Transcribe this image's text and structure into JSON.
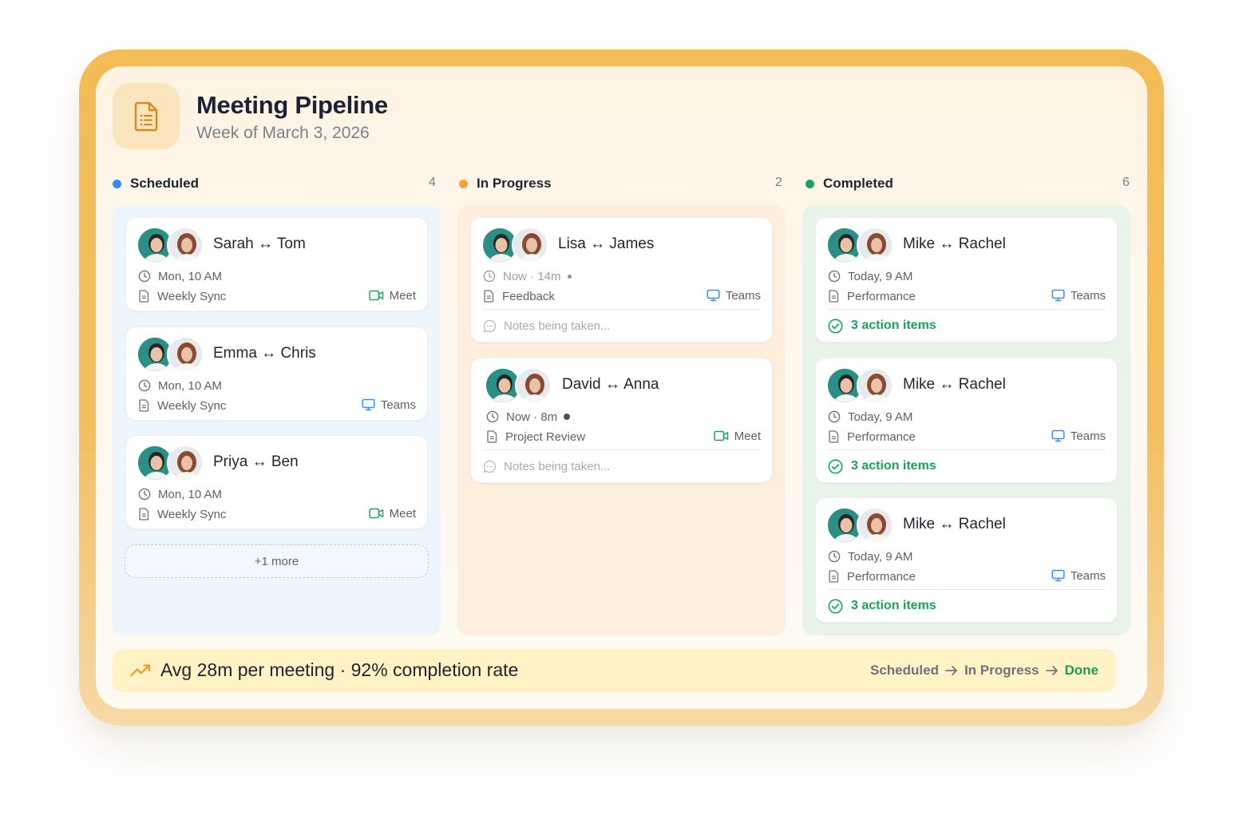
{
  "header": {
    "title": "Meeting Pipeline",
    "subtitle": "Week of March 3, 2026",
    "icon": "document-list-icon"
  },
  "columns": [
    {
      "name": "Scheduled",
      "count": "4",
      "dot_color": "#2f8cf0",
      "bg_color": "#eef6fd",
      "more_label": "+1 more",
      "cards": [
        {
          "title": "Sarah ↔ Tom",
          "time": "Mon, 10 AM",
          "topic": "Weekly Sync",
          "platform": "Meet",
          "platform_icon": "video-camera-icon"
        },
        {
          "title": "Emma ↔ Chris",
          "time": "Mon, 10 AM",
          "topic": "Weekly Sync",
          "platform": "Teams",
          "platform_icon": "monitor-icon"
        },
        {
          "title": "Priya ↔ Ben",
          "time": "Mon, 10 AM",
          "topic": "Weekly Sync",
          "platform": "Meet",
          "platform_icon": "video-camera-icon"
        }
      ]
    },
    {
      "name": "In Progress",
      "count": "2",
      "dot_color": "#f0a23a",
      "bg_color": "#fdeedd",
      "cards": [
        {
          "title": "Lisa ↔ James",
          "time": "Now · 14m",
          "topic": "Feedback",
          "platform": "Teams",
          "platform_icon": "monitor-icon",
          "notes": "Notes being taken..."
        },
        {
          "title": "David ↔ Anna",
          "time": "Now · 8m",
          "topic": "Project Review",
          "platform": "Meet",
          "platform_icon": "video-camera-icon",
          "notes": "Notes being taken..."
        }
      ]
    },
    {
      "name": "Completed",
      "count": "6",
      "dot_color": "#18a35a",
      "bg_color": "#e9f4e9",
      "cards": [
        {
          "title": "Mike ↔ Rachel",
          "time": "Today, 9 AM",
          "topic": "Performance",
          "platform": "Teams",
          "platform_icon": "monitor-icon",
          "actions": "3 action items"
        },
        {
          "title": "Mike ↔ Rachel",
          "time": "Today, 9 AM",
          "topic": "Performance",
          "platform": "Teams",
          "platform_icon": "monitor-icon",
          "actions": "3 action items"
        },
        {
          "title": "Mike ↔ Rachel",
          "time": "Today, 9 AM",
          "topic": "Performance",
          "platform": "Teams",
          "platform_icon": "monitor-icon",
          "actions": "3 action items"
        }
      ]
    }
  ],
  "footer": {
    "stat": "Avg 28m per meeting · 92% completion rate",
    "flow": [
      "Scheduled",
      "In Progress",
      "Done"
    ]
  },
  "colors": {
    "frame": "#f4bc55",
    "accent_green": "#18a35a",
    "accent_blue": "#2f8cf0",
    "accent_orange": "#f0a23a"
  }
}
